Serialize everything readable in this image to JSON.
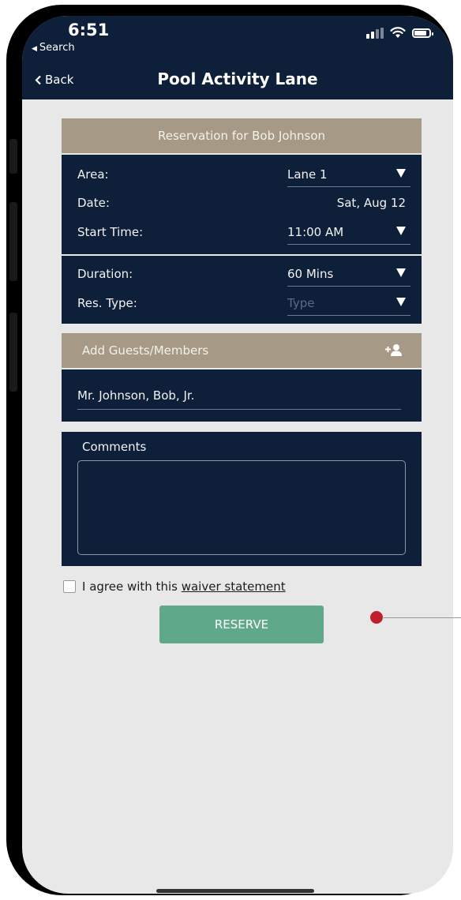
{
  "status_bar": {
    "time": "6:51",
    "back_app": "Search"
  },
  "nav": {
    "back_label": "Back",
    "title": "Pool Activity Lane"
  },
  "reservation": {
    "header": "Reservation for Bob Johnson",
    "area": {
      "label": "Area:",
      "value": "Lane 1"
    },
    "date": {
      "label": "Date:",
      "value": "Sat, Aug 12"
    },
    "start_time": {
      "label": "Start Time:",
      "value": "11:00 AM"
    },
    "duration": {
      "label": "Duration:",
      "value": "60 Mins"
    },
    "res_type": {
      "label": "Res. Type:",
      "placeholder": "Type"
    }
  },
  "guests": {
    "header": "Add Guests/Members",
    "items": [
      "Mr. Johnson, Bob, Jr."
    ]
  },
  "comments": {
    "label": "Comments",
    "value": ""
  },
  "waiver": {
    "prefix": "I agree with this",
    "link": "waiver statement",
    "checked": false
  },
  "reserve_button": {
    "label": "RESERVE"
  },
  "colors": {
    "navy": "#0e1f3a",
    "gold": "#a69a87",
    "button_green": "#5fa98a",
    "background": "#e8e8e8"
  },
  "icons": [
    "signal-icon",
    "wifi-icon",
    "battery-icon",
    "chevron-left-icon",
    "dropdown-caret-icon",
    "add-person-icon",
    "checkbox-icon"
  ]
}
